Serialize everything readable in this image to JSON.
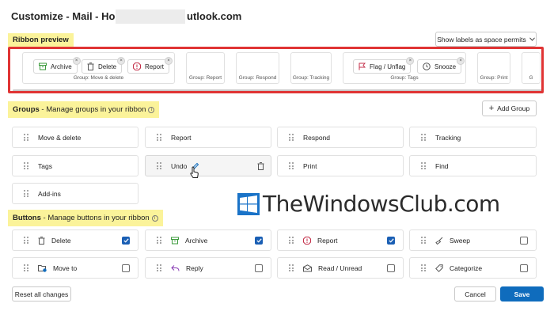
{
  "dialog": {
    "title_prefix": "Customize - Mail - Home",
    "title_suffix": "utlook.com"
  },
  "ribbon_preview": {
    "label": "Ribbon preview",
    "labels_toggle": "Show labels as space permits",
    "groups": [
      {
        "label": "Group: Move & delete",
        "buttons": [
          {
            "label": "Archive",
            "icon": "archive-icon"
          },
          {
            "label": "Delete",
            "icon": "trash-icon"
          },
          {
            "label": "Report",
            "icon": "report-icon"
          }
        ]
      },
      {
        "label": "Group: Report"
      },
      {
        "label": "Group: Respond"
      },
      {
        "label": "Group: Tracking"
      },
      {
        "label": "Group: Tags",
        "buttons": [
          {
            "label": "Flag / Unflag",
            "icon": "flag-icon"
          },
          {
            "label": "Snooze",
            "icon": "clock-icon"
          }
        ]
      },
      {
        "label": "Group: Print"
      }
    ]
  },
  "groups": {
    "title": "Groups",
    "subtitle": " - Manage groups in your ribbon",
    "add_button": "Add Group",
    "items": [
      "Move & delete",
      "Report",
      "Respond",
      "Tracking",
      "Tags",
      "Undo",
      "Print",
      "Find",
      "Add-ins"
    ]
  },
  "buttons": {
    "title": "Buttons",
    "subtitle": " - Manage buttons in your ribbon",
    "items": [
      {
        "label": "Delete",
        "icon": "trash-icon",
        "checked": true
      },
      {
        "label": "Archive",
        "icon": "archive-icon",
        "checked": true
      },
      {
        "label": "Report",
        "icon": "report-icon",
        "checked": true
      },
      {
        "label": "Sweep",
        "icon": "broom-icon",
        "checked": false
      },
      {
        "label": "Move to",
        "icon": "folder-move-icon",
        "checked": false
      },
      {
        "label": "Reply",
        "icon": "reply-icon",
        "checked": false
      },
      {
        "label": "Read / Unread",
        "icon": "envelope-icon",
        "checked": false
      },
      {
        "label": "Categorize",
        "icon": "tag-icon",
        "checked": false
      }
    ]
  },
  "footer": {
    "reset": "Reset all changes",
    "cancel": "Cancel",
    "save": "Save"
  },
  "watermark": "TheWindowsClub.com",
  "colors": {
    "highlight": "#fbf39a",
    "annotation_red": "#e03434",
    "primary": "#0f6cbd",
    "archive_green": "#3a9a3a",
    "report_red": "#c4314b",
    "reply_purple": "#8a3fb5"
  }
}
